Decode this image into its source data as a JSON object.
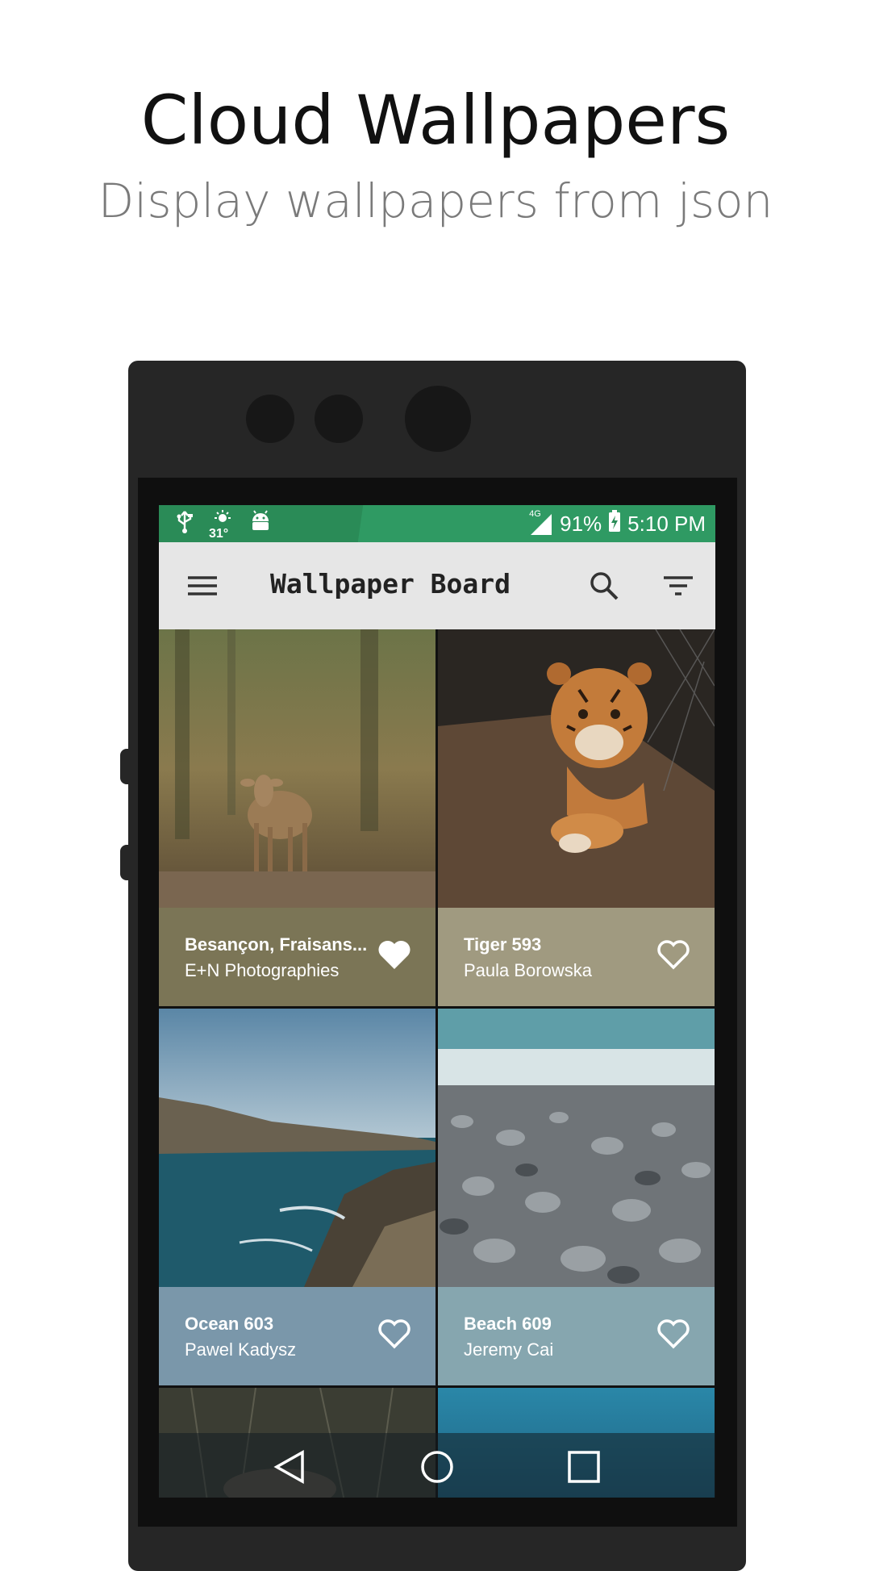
{
  "promo": {
    "title": "Cloud Wallpapers",
    "subtitle": "Display wallpapers from json"
  },
  "statusbar": {
    "icons_left": [
      "usb-icon",
      "weather-icon",
      "android-icon"
    ],
    "temperature": "31°",
    "network": "4G",
    "battery": "91%",
    "time": "5:10 PM",
    "color": "#2a8b57"
  },
  "toolbar": {
    "title": "Wallpaper Board",
    "menu_icon": "menu-icon",
    "search_icon": "search-icon",
    "filter_icon": "filter-icon"
  },
  "wallpapers": [
    {
      "title": "Besançon, Fraisans...",
      "author": "E+N Photographies",
      "caption_color": "#7b7556",
      "favorite": true,
      "subject": "deer"
    },
    {
      "title": "Tiger 593",
      "author": "Paula Borowska",
      "caption_color": "#a09a80",
      "favorite": false,
      "subject": "tiger"
    },
    {
      "title": "Ocean 603",
      "author": "Pawel Kadysz",
      "caption_color": "#7a97aa",
      "favorite": false,
      "subject": "ocean"
    },
    {
      "title": "Beach 609",
      "author": "Jeremy Cai",
      "caption_color": "#86a6af",
      "favorite": false,
      "subject": "beach"
    }
  ],
  "navbar": {
    "back_icon": "back-icon",
    "home_icon": "home-icon",
    "recents_icon": "recents-icon"
  }
}
